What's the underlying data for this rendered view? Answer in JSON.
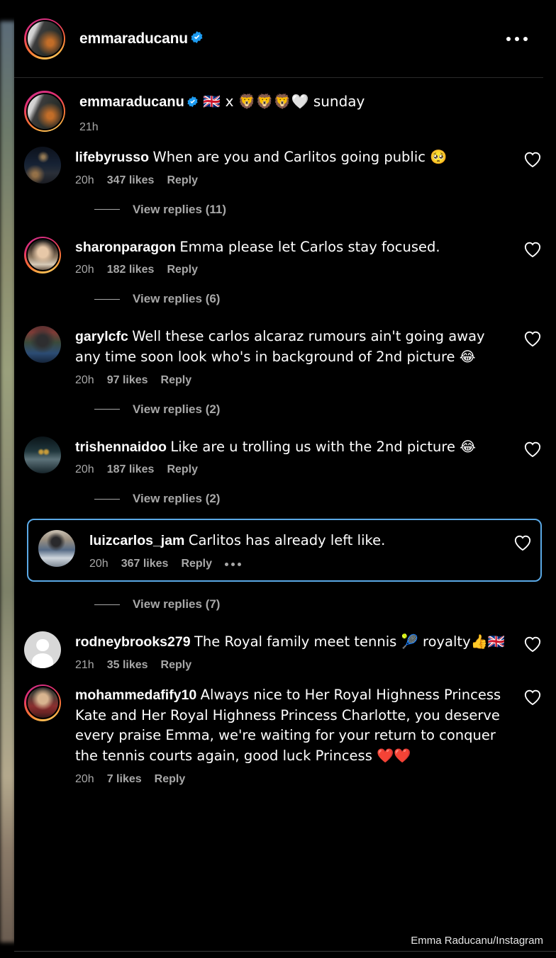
{
  "app": "instagram-comments",
  "colors": {
    "background": "#000000",
    "text_primary": "#ffffff",
    "text_secondary": "#a8a8a8",
    "verified_blue": "#1d9bf0",
    "highlight_border": "#5aa9e6",
    "divider": "#2a2a2a"
  },
  "header": {
    "username": "emmaraducanu",
    "verified": true,
    "menu_label": "More options"
  },
  "caption": {
    "username": "emmaraducanu",
    "verified": true,
    "text": "🇬🇧 x 🦁🦁🦁🤍 sunday",
    "time": "21h"
  },
  "comments": [
    {
      "username": "lifebyrusso",
      "text": "When are you and Carlitos going public 🥺",
      "time": "20h",
      "likes": "347 likes",
      "reply": "Reply",
      "avatar": "av-city",
      "ring": false,
      "highlighted": false,
      "has_menu": false,
      "view_replies": "View replies (11)"
    },
    {
      "username": "sharonparagon",
      "text": "Emma please let Carlos stay focused.",
      "time": "20h",
      "likes": "182 likes",
      "reply": "Reply",
      "avatar": "av-sharon",
      "ring": true,
      "highlighted": false,
      "has_menu": false,
      "view_replies": "View replies (6)"
    },
    {
      "username": "garylcfc",
      "text": "Well these carlos alcaraz rumours ain't going away any time soon look who's in background of 2nd picture 😂",
      "time": "20h",
      "likes": "97 likes",
      "reply": "Reply",
      "avatar": "av-gary",
      "ring": false,
      "highlighted": false,
      "has_menu": false,
      "view_replies": "View replies (2)"
    },
    {
      "username": "trishennaidoo",
      "text": "Like are u trolling us with the 2nd picture 😂",
      "time": "20h",
      "likes": "187 likes",
      "reply": "Reply",
      "avatar": "av-trish",
      "ring": false,
      "highlighted": false,
      "has_menu": false,
      "view_replies": "View replies (2)"
    },
    {
      "username": "luizcarlos_jam",
      "text": "Carlitos has already left like.",
      "time": "20h",
      "likes": "367 likes",
      "reply": "Reply",
      "avatar": "av-luiz",
      "ring": false,
      "highlighted": true,
      "has_menu": true,
      "view_replies": "View replies (7)"
    },
    {
      "username": "rodneybrooks279",
      "text": "The Royal family meet tennis 🎾 royalty👍🇬🇧",
      "time": "21h",
      "likes": "35 likes",
      "reply": "Reply",
      "avatar": "av-default",
      "ring": false,
      "highlighted": false,
      "has_menu": false,
      "view_replies": null
    },
    {
      "username": "mohammedafify10",
      "text": "Always nice to Her Royal Highness Princess Kate and Her Royal Highness Princess Charlotte, you deserve every praise Emma, we're waiting for your return to conquer the tennis courts again, good luck Princess ❤️❤️",
      "time": "20h",
      "likes": "7 likes",
      "reply": "Reply",
      "avatar": "av-moh",
      "ring": true,
      "highlighted": false,
      "has_menu": false,
      "view_replies": null
    }
  ],
  "footer": {
    "credit": "Emma Raducanu/Instagram"
  }
}
